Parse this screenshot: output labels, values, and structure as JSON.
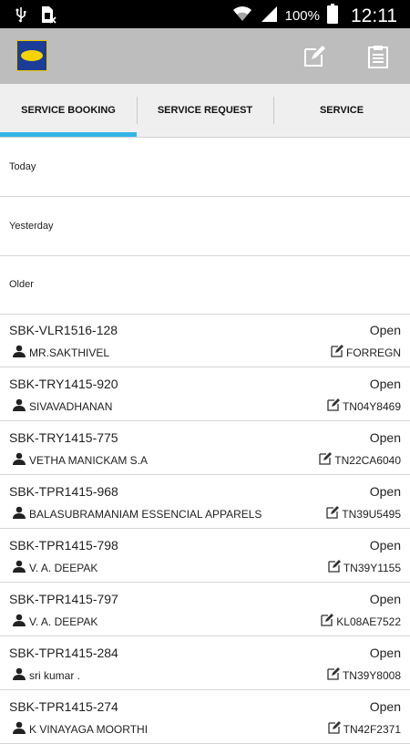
{
  "status_bar": {
    "battery_text": "100%",
    "clock": "12:11",
    "icons": [
      "usb-icon",
      "sim-missing-icon",
      "wifi-icon",
      "signal-icon",
      "battery-icon"
    ]
  },
  "app_bar": {
    "icons": [
      "app-logo",
      "edit-icon",
      "clipboard-icon"
    ]
  },
  "tabs": [
    {
      "label": "SERVICE BOOKING",
      "active": true
    },
    {
      "label": "SERVICE REQUEST",
      "active": false
    },
    {
      "label": "SERVICE",
      "active": false
    }
  ],
  "sections": [
    {
      "label": "Today"
    },
    {
      "label": "Yesterday"
    },
    {
      "label": "Older"
    }
  ],
  "bookings": [
    {
      "id": "SBK-VLR1516-128",
      "status": "Open",
      "customer": "MR.SAKTHIVEL",
      "vehicle": "FORREGN"
    },
    {
      "id": "SBK-TRY1415-920",
      "status": "Open",
      "customer": "SIVAVADHANAN",
      "vehicle": "TN04Y8469"
    },
    {
      "id": "SBK-TRY1415-775",
      "status": "Open",
      "customer": "VETHA MANICKAM  S.A",
      "vehicle": "TN22CA6040"
    },
    {
      "id": "SBK-TPR1415-968",
      "status": "Open",
      "customer": "BALASUBRAMANIAM  ESSENCIAL APPARELS",
      "vehicle": "TN39U5495"
    },
    {
      "id": "SBK-TPR1415-798",
      "status": "Open",
      "customer": "V. A. DEEPAK",
      "vehicle": "TN39Y1155"
    },
    {
      "id": "SBK-TPR1415-797",
      "status": "Open",
      "customer": "V. A. DEEPAK",
      "vehicle": "KL08AE7522"
    },
    {
      "id": "SBK-TPR1415-284",
      "status": "Open",
      "customer": "sri kumar .",
      "vehicle": "TN39Y8008"
    },
    {
      "id": "SBK-TPR1415-274",
      "status": "Open",
      "customer": "K    VINAYAGA MOORTHI",
      "vehicle": "TN42F2371"
    }
  ],
  "colors": {
    "accent": "#33b5e5",
    "app_bar": "#bdbdbd",
    "tab_bar": "#efefef"
  }
}
